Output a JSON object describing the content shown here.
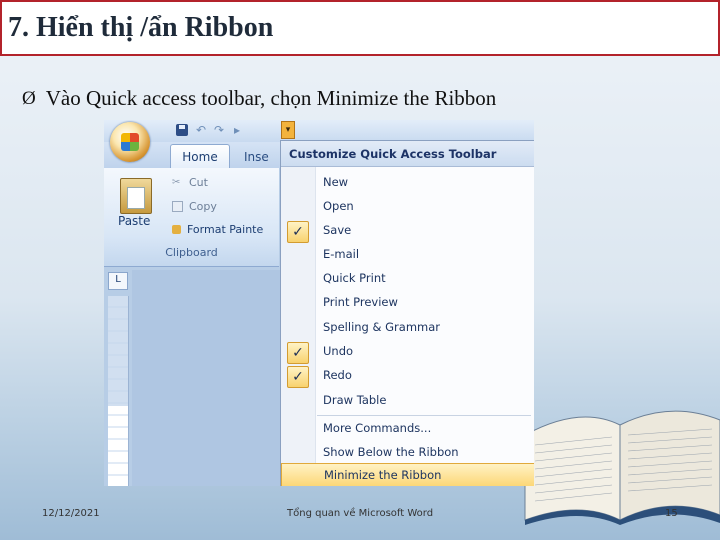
{
  "slide": {
    "title": "7. Hiển thị /ẩn Ribbon",
    "bullet_symbol": "Ø",
    "bullet_text": "Vào Quick access toolbar, chọn Minimize the Ribbon"
  },
  "screenshot": {
    "tabs": [
      "Home",
      "Inse"
    ],
    "ribbon": {
      "paste_label": "Paste",
      "commands": [
        "Cut",
        "Copy",
        "Format Painte"
      ],
      "group_label": "Clipboard"
    },
    "menu": {
      "header": "Customize Quick Access Toolbar",
      "items": [
        {
          "label": "New",
          "checked": false
        },
        {
          "label": "Open",
          "checked": false
        },
        {
          "label": "Save",
          "checked": true
        },
        {
          "label": "E-mail",
          "checked": false
        },
        {
          "label": "Quick Print",
          "checked": false
        },
        {
          "label": "Print Preview",
          "checked": false
        },
        {
          "label": "Spelling & Grammar",
          "checked": false
        },
        {
          "label": "Undo",
          "checked": true
        },
        {
          "label": "Redo",
          "checked": true
        },
        {
          "label": "Draw Table",
          "checked": false
        }
      ],
      "more_commands": "More Commands...",
      "show_below": "Show Below the Ribbon",
      "minimize": "Minimize the Ribbon"
    }
  },
  "footer": {
    "date": "12/12/2021",
    "center": "Tổng quan về Microsoft Word",
    "page": "15"
  }
}
